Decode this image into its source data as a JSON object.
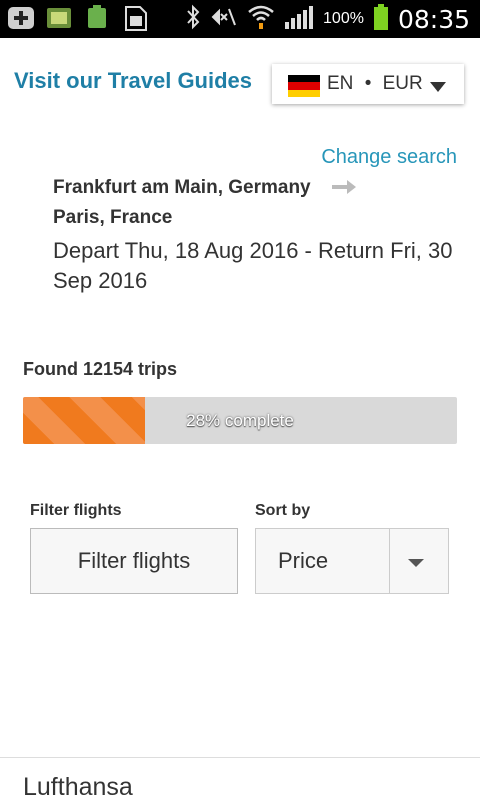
{
  "status_bar": {
    "battery_percent": "100%",
    "time": "08:35",
    "icons": [
      "add-icon",
      "sim-2in1-icon",
      "battery-full-icon",
      "sim-card-icon",
      "bluetooth-icon",
      "mute-icon",
      "wifi-icon",
      "signal-icon",
      "battery-icon"
    ],
    "mini_battery_label": "100%",
    "sim_label": "2:1"
  },
  "header": {
    "guides_link": "Visit our Travel Guides",
    "locale": {
      "language": "EN",
      "separator": "•",
      "currency": "EUR",
      "flag": "germany-flag-icon"
    }
  },
  "search": {
    "change_search": "Change search",
    "origin": "Frankfurt am Main, Germany",
    "destination": "Paris, France",
    "dates": "Depart Thu, 18 Aug 2016 - Return Fri, 30 Sep 2016"
  },
  "results": {
    "found_text": "Found 12154 trips",
    "progress_fraction": 0.28,
    "progress_label": "28% complete"
  },
  "controls": {
    "filter_label": "Filter flights",
    "filter_button": "Filter flights",
    "sort_label": "Sort by",
    "sort_value": "Price"
  },
  "first_result": {
    "airline": "Lufthansa"
  },
  "colors": {
    "link_blue": "#1f7fa6",
    "progress_orange": "#f07a1e",
    "progress_track": "#d9d9d9"
  }
}
